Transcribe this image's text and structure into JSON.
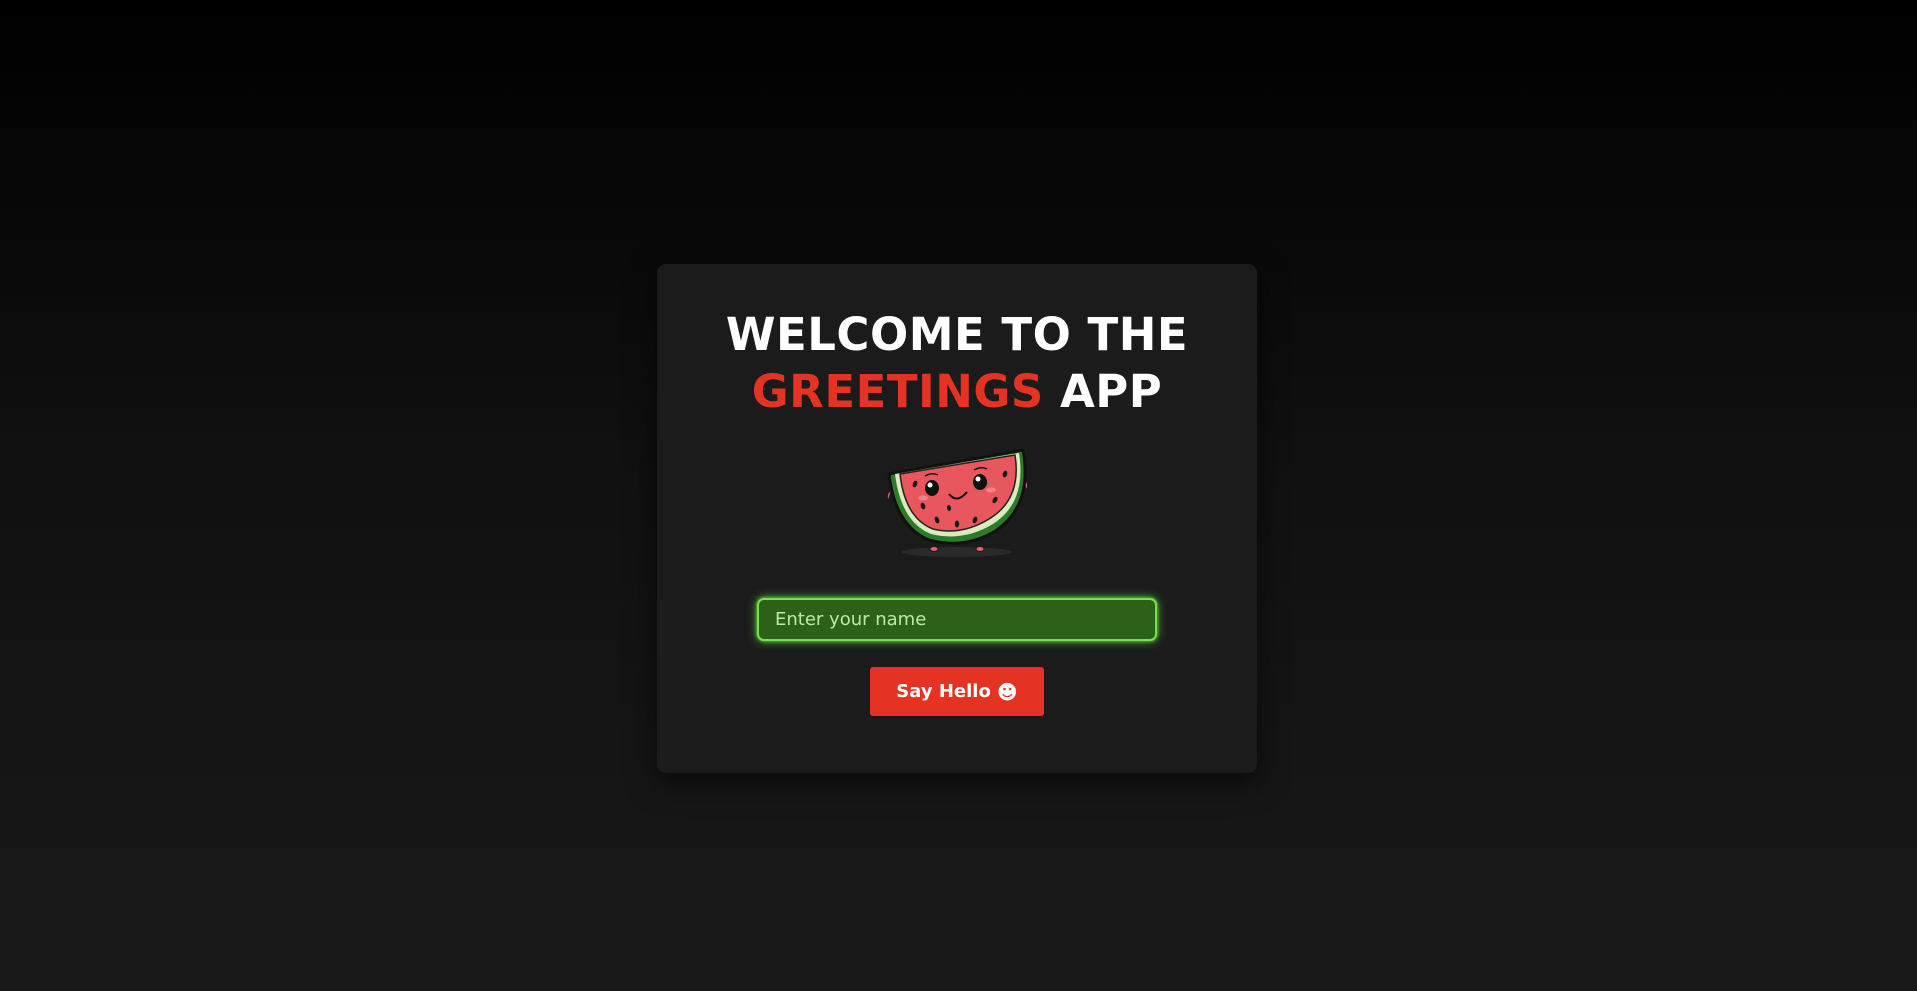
{
  "header": {
    "line1": "WELCOME TO THE",
    "accent_word": "GREETINGS",
    "line2_rest": "APP"
  },
  "mascot": {
    "icon": "watermelon-mascot-icon"
  },
  "form": {
    "name_placeholder": "Enter your name",
    "name_value": "",
    "button_label": "Say Hello",
    "button_icon": "☻"
  },
  "colors": {
    "accent": "#e53323",
    "input_bg": "#2d6119",
    "input_border": "#74e34a",
    "card_bg": "#1b1b1b"
  }
}
